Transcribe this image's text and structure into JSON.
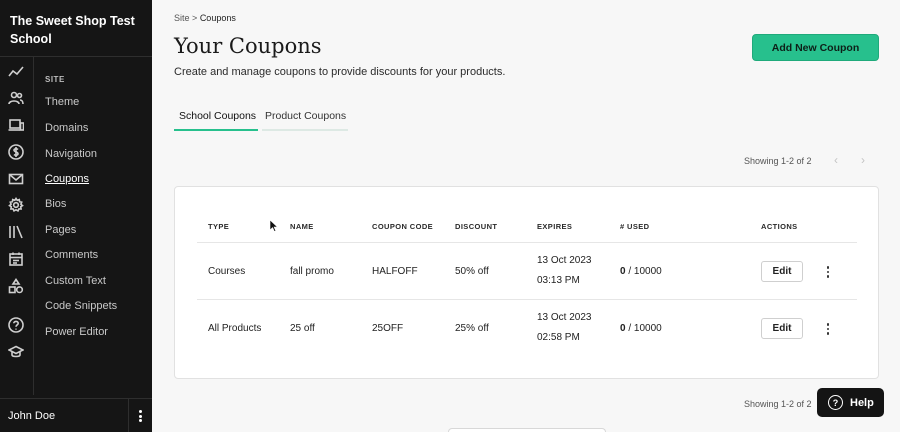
{
  "sidebar": {
    "school_name": "The Sweet Shop Test School",
    "section_label": "SITE",
    "icons": [
      "analytics-icon",
      "users-icon",
      "devices-icon",
      "dollar-icon",
      "mail-icon",
      "gear-icon",
      "library-icon",
      "calendar-icon",
      "shapes-icon",
      "help-circle-icon",
      "graduation-cap-icon"
    ],
    "items": [
      {
        "label": "Theme"
      },
      {
        "label": "Domains"
      },
      {
        "label": "Navigation"
      },
      {
        "label": "Coupons",
        "active": true
      },
      {
        "label": "Bios"
      },
      {
        "label": "Pages"
      },
      {
        "label": "Comments"
      },
      {
        "label": "Custom Text"
      },
      {
        "label": "Code Snippets"
      },
      {
        "label": "Power Editor"
      }
    ],
    "user_name": "John Doe"
  },
  "breadcrumb": {
    "parent": "Site",
    "separator": ">",
    "current": "Coupons"
  },
  "header": {
    "title": "Your Coupons",
    "subtitle": "Create and manage coupons to provide discounts for your products.",
    "add_button": "Add New Coupon"
  },
  "tabs": [
    {
      "label": "School Coupons",
      "active": true
    },
    {
      "label": "Product Coupons",
      "active": false
    }
  ],
  "pagination": {
    "top": "Showing 1-2 of 2",
    "bottom": "Showing 1-2 of 2",
    "prev": "‹",
    "next": "›"
  },
  "table": {
    "columns": [
      "TYPE",
      "NAME",
      "COUPON CODE",
      "DISCOUNT",
      "EXPIRES",
      "# USED",
      "ACTIONS"
    ],
    "rows": [
      {
        "type": "Courses",
        "name": "fall promo",
        "code": "HALFOFF",
        "discount": "50% off",
        "expires_date": "13 Oct 2023",
        "expires_time": "03:13 PM",
        "used": "0",
        "limit": " / 10000",
        "edit": "Edit"
      },
      {
        "type": "All Products",
        "name": "25 off",
        "code": "25OFF",
        "discount": "25% off",
        "expires_date": "13 Oct 2023",
        "expires_time": "02:58 PM",
        "used": "0",
        "limit": " / 10000",
        "edit": "Edit"
      }
    ]
  },
  "help": {
    "label": "Help"
  },
  "colors": {
    "accent": "#27c08d",
    "sidebar_bg": "#151515",
    "page_bg": "#f7f7f7"
  }
}
